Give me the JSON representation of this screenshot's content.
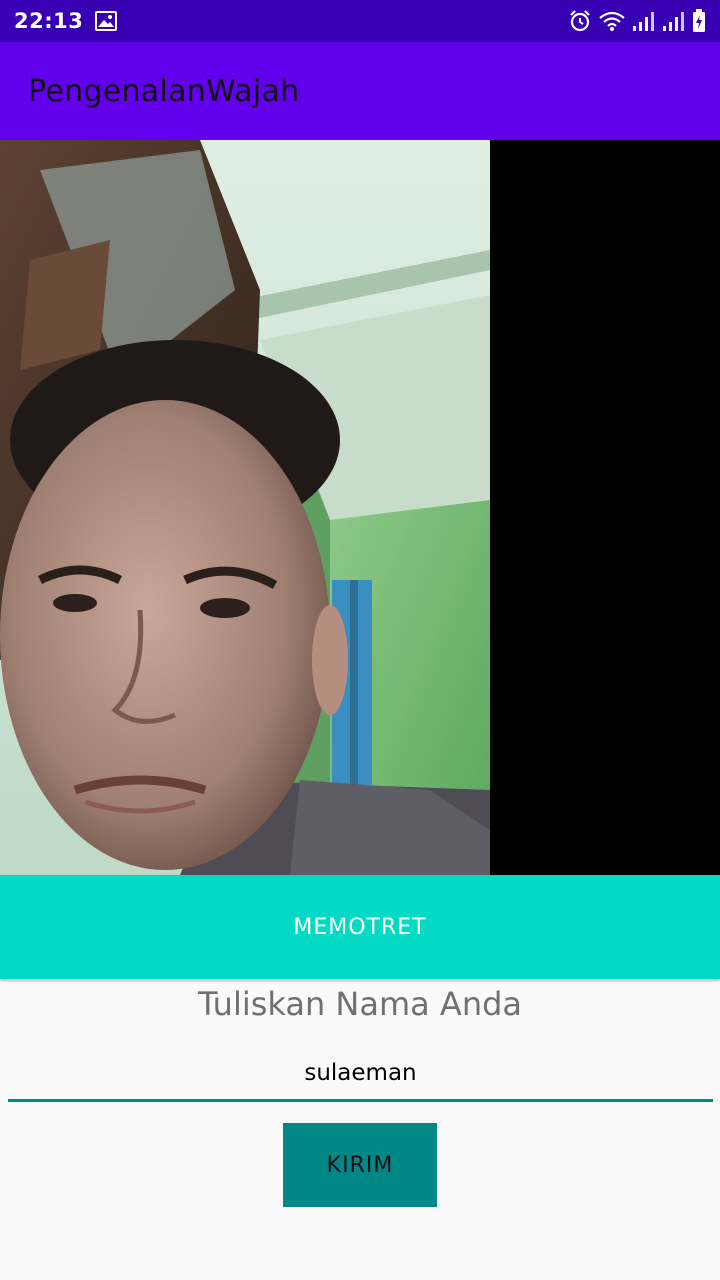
{
  "status_bar": {
    "time": "22:13",
    "icons": [
      "gallery-icon",
      "alarm-icon",
      "wifi-icon",
      "signal-icon",
      "signal-icon",
      "battery-charging-icon"
    ]
  },
  "app_bar": {
    "title": "PengenalanWajah"
  },
  "preview": {
    "image": "camera-photo"
  },
  "capture_button": {
    "label": "MEMOTRET"
  },
  "form": {
    "title": "Tuliskan Nama Anda",
    "name_value": "sulaeman",
    "submit_label": "KIRIM"
  },
  "colors": {
    "status_bar": "#3700b3",
    "app_bar": "#6200ee",
    "accent": "#03dac5",
    "primary_dark_teal": "#018786"
  }
}
